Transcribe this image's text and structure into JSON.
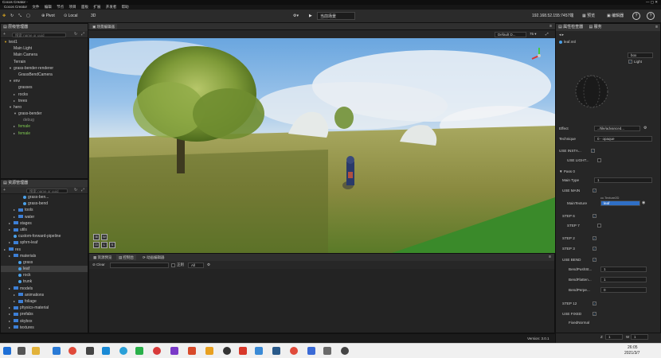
{
  "window": {
    "title": "Cocos Creator - ",
    "app_name": "Cocos Creator"
  },
  "menu": [
    "文件",
    "编辑",
    "节点",
    "项目",
    "面板",
    "扩展",
    "开发者",
    "帮助"
  ],
  "toolbar": {
    "pivot": "Pivot",
    "local": "Local",
    "view3d": "3D",
    "play_mode": "当前场景",
    "ip": "192.168.52.155:7457端",
    "preview": "预览",
    "editor": "编辑器"
  },
  "hierarchy": {
    "title": "层级管理器",
    "search_placeholder": "搜索 name or uuid",
    "items": [
      {
        "label": "test1",
        "depth": 0,
        "arrow": "▼",
        "kind": "scene"
      },
      {
        "label": "Main Light",
        "depth": 1,
        "arrow": "",
        "kind": "node"
      },
      {
        "label": "Main Camera",
        "depth": 1,
        "arrow": "",
        "kind": "node"
      },
      {
        "label": "Terrain",
        "depth": 1,
        "arrow": "",
        "kind": "node"
      },
      {
        "label": "grass-bender-renderer",
        "depth": 1,
        "arrow": "▼",
        "kind": "node"
      },
      {
        "label": "GrassBendCamera",
        "depth": 2,
        "arrow": "",
        "kind": "node"
      },
      {
        "label": "env",
        "depth": 1,
        "arrow": "▼",
        "kind": "node"
      },
      {
        "label": "grasses",
        "depth": 2,
        "arrow": "",
        "kind": "node"
      },
      {
        "label": "rocks",
        "depth": 2,
        "arrow": "▸",
        "kind": "node"
      },
      {
        "label": "trees",
        "depth": 2,
        "arrow": "▸",
        "kind": "node"
      },
      {
        "label": "hero",
        "depth": 1,
        "arrow": "▼",
        "kind": "node"
      },
      {
        "label": "grass-bender",
        "depth": 2,
        "arrow": "▼",
        "kind": "node"
      },
      {
        "label": "debug",
        "depth": 3,
        "arrow": "",
        "kind": "muted"
      },
      {
        "label": "female",
        "depth": 2,
        "arrow": "▸",
        "kind": "green"
      },
      {
        "label": "female",
        "depth": 2,
        "arrow": "▸",
        "kind": "green"
      }
    ]
  },
  "assets": {
    "title": "资源管理器",
    "search_placeholder": "搜索 name or uuid",
    "items": [
      {
        "label": "grass-ben...",
        "depth": 3,
        "kind": "file"
      },
      {
        "label": "grass-bend",
        "depth": 3,
        "kind": "file"
      },
      {
        "label": "tools",
        "depth": 2,
        "kind": "folder"
      },
      {
        "label": "water",
        "depth": 2,
        "kind": "folder"
      },
      {
        "label": "stages",
        "depth": 1,
        "kind": "folder"
      },
      {
        "label": "utils",
        "depth": 1,
        "kind": "folder"
      },
      {
        "label": "custom-forward-pipeline",
        "depth": 1,
        "kind": "file"
      },
      {
        "label": "sphrn-leaf",
        "depth": 1,
        "kind": "folder"
      },
      {
        "label": "res",
        "depth": 0,
        "kind": "folder"
      },
      {
        "label": "materials",
        "depth": 1,
        "kind": "folder"
      },
      {
        "label": "grass",
        "depth": 2,
        "kind": "file"
      },
      {
        "label": "leaf",
        "depth": 2,
        "kind": "file",
        "selected": true
      },
      {
        "label": "rock",
        "depth": 2,
        "kind": "file"
      },
      {
        "label": "trunk",
        "depth": 2,
        "kind": "file"
      },
      {
        "label": "models",
        "depth": 1,
        "kind": "folder"
      },
      {
        "label": "animations",
        "depth": 2,
        "kind": "folder"
      },
      {
        "label": "foliage",
        "depth": 2,
        "kind": "folder"
      },
      {
        "label": "physics-material",
        "depth": 1,
        "kind": "folder"
      },
      {
        "label": "prefabs",
        "depth": 1,
        "kind": "folder"
      },
      {
        "label": "skybox",
        "depth": 1,
        "kind": "folder"
      },
      {
        "label": "textures",
        "depth": 1,
        "kind": "folder"
      }
    ]
  },
  "scene": {
    "tab": "场景编辑器",
    "camera_select": "Default D...",
    "zoom": "75"
  },
  "console": {
    "tabs": [
      "资源预览",
      "控制台",
      "动画编辑器"
    ],
    "clear": "Clear",
    "regex": "正则",
    "level": "All"
  },
  "inspector": {
    "tabs": [
      "属性检查器",
      "服务"
    ],
    "asset_name": "leaf.mtl",
    "preview_mode": "box",
    "light_label": "Light",
    "effect_label": "Effect",
    "effect_value": "../tile/advanced...",
    "technique_label": "Technique",
    "technique_value": "0 - opaque",
    "use_instancing": "USE INSTA...",
    "use_lightmap": "USE LIGHT...",
    "pass_label": "Pass 0",
    "main_type_label": "Main Type",
    "main_type_value": "1",
    "use_main": "USE MAIN",
    "main_tex_label": "MainTexture",
    "main_tex_hint": "cc.Texture2D",
    "main_tex_value": "leaf",
    "step6": "STEP 6",
    "step7": "STEP 7",
    "step2": "STEP 2",
    "step3": "STEP 3",
    "use_bend": "USE BEND",
    "bend_push": "BendPushSt...",
    "bend_push_val": "1",
    "bend_flatten": "BendFlatten...",
    "bend_flatten_val": "1",
    "bend_perp": "BendPerpe...",
    "bend_perp_val": "0",
    "step12": "STEP 12",
    "use_fixed": "USE FIXED",
    "fixed_normal": "FixedNormal",
    "fx": "X",
    "fy": "Y",
    "fx_val": "0.5",
    "fy_val": "0.5",
    "fz": "Z",
    "fw": "W",
    "fz_val": "1",
    "fw_val": "1"
  },
  "status": {
    "version": "Version: 3.0.1",
    "zero": "0"
  },
  "taskbar": {
    "time": "26:05",
    "date": "2021/3/7"
  },
  "colors": {
    "accent": "#3d7fd6",
    "green": "#7ec850"
  }
}
